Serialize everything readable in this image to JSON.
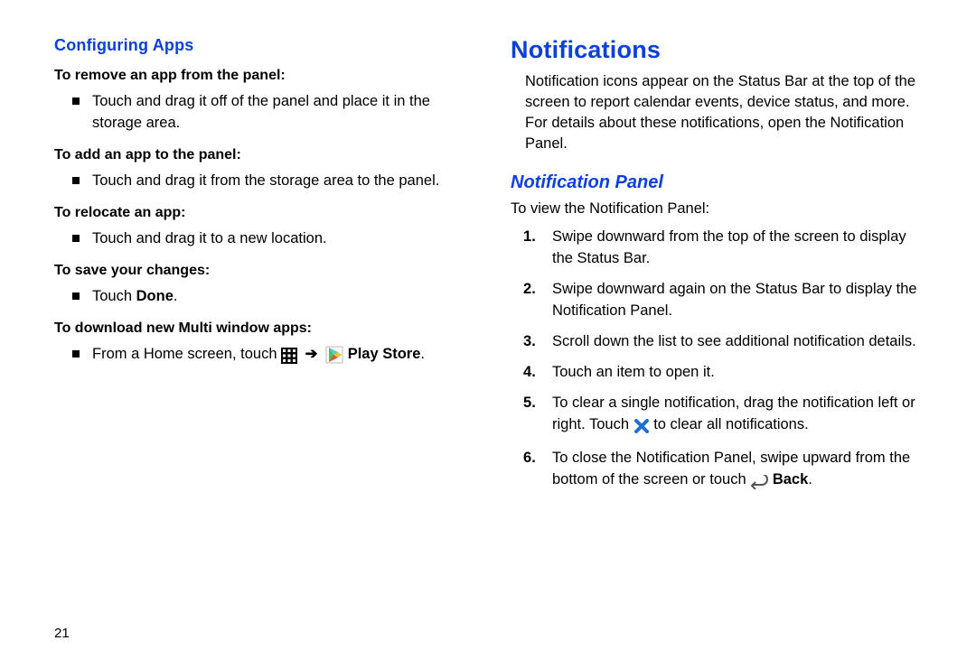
{
  "left": {
    "heading": "Configuring Apps",
    "sub1": "To remove an app from the panel:",
    "sub1_item": "Touch and drag it off of the panel and place it in the storage area.",
    "sub2": "To add an app to the panel:",
    "sub2_item": "Touch and drag it from the storage area to the panel.",
    "sub3": "To relocate an app:",
    "sub3_item": "Touch and drag it to a new location.",
    "sub4": "To save your changes:",
    "sub4_pre": "Touch ",
    "sub4_bold": "Done",
    "sub4_post": ".",
    "sub5": "To download new Multi window apps:",
    "sub5_pre": "From a Home screen, touch ",
    "sub5_playstore": " Play Store",
    "sub5_post": ".",
    "page_number": "21"
  },
  "right": {
    "title": "Notifications",
    "intro": "Notification icons appear on the Status Bar at the top of the screen to report calendar events, device status, and more. For details about these notifications, open the Notification Panel.",
    "panel_heading": "Notification Panel",
    "panel_intro": "To view the Notification Panel:",
    "step1": "Swipe downward from the top of the screen to display the Status Bar.",
    "step2": "Swipe downward again on the Status Bar to display the Notification Panel.",
    "step3": "Scroll down the list to see additional notification details.",
    "step4": "Touch an item to open it.",
    "step5_pre": "To clear a single notification, drag the notification left or right. Touch ",
    "step5_post": " to clear all notifications.",
    "step6_pre": "To close the Notification Panel, swipe upward from the bottom of the screen or touch ",
    "step6_bold": " Back",
    "step6_post": "."
  }
}
